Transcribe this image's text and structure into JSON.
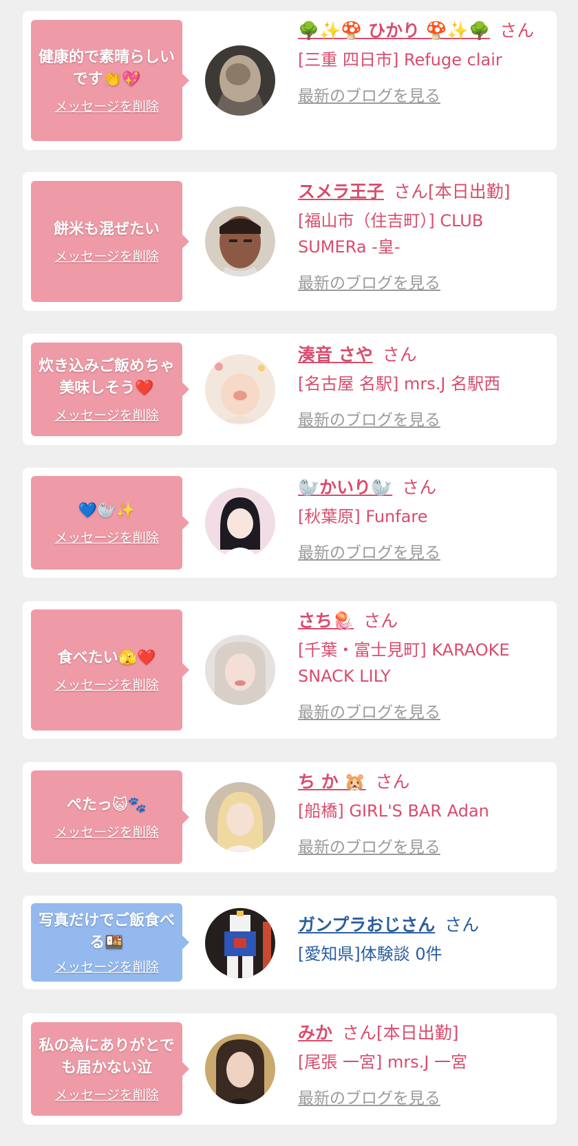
{
  "delete_label": "メッセージを削除",
  "blog_label": "最新のブログを見る",
  "colors": {
    "pink_bubble": "#ef9aa7",
    "blue_bubble": "#94b9ee",
    "pink_text": "#d94b6c",
    "blue_text": "#2a5d9f"
  },
  "items": [
    {
      "message": "健康的で素晴らしいです👏💖",
      "name": "🌳✨🍄 ひかり 🍄✨🌳",
      "suffix": "さん",
      "shop": "[三重 四日市] Refuge clair",
      "theme": "pink"
    },
    {
      "message": "餅米も混ぜたい",
      "name": "スメラ王子",
      "suffix": "さん[本日出勤]",
      "shop": "[福山市（住吉町）] CLUB SUMERa -皇-",
      "theme": "pink"
    },
    {
      "message": "炊き込みご飯めちゃ美味しそう❤️",
      "name": "湊音 さや",
      "suffix": "さん",
      "shop": "[名古屋 名駅] mrs.J 名駅西",
      "theme": "pink"
    },
    {
      "message": "💙🦭✨",
      "name": "🦭かいり🦭",
      "suffix": "さん",
      "shop": "[秋葉原] Funfare",
      "theme": "pink"
    },
    {
      "message": "食べたい🫣❤️",
      "name": "さち🪼",
      "suffix": "さん",
      "shop": "[千葉・富士見町] KARAOKE SNACK LILY",
      "theme": "pink"
    },
    {
      "message": "ぺたっ😺🐾",
      "name": "ち か 🐹",
      "suffix": "さん",
      "shop": "[船橋] GIRL'S BAR Adan",
      "theme": "pink"
    },
    {
      "message": "写真だけでご飯食べる🍱",
      "name": "ガンプラおじさん",
      "suffix": "さん",
      "shop": "[愛知県]体験談 0件",
      "theme": "blue"
    },
    {
      "message": "私の為にありがとでも届かない泣",
      "name": "みか",
      "suffix": "さん[本日出勤]",
      "shop": "[尾張 一宮] mrs.J 一宮",
      "theme": "pink"
    }
  ]
}
